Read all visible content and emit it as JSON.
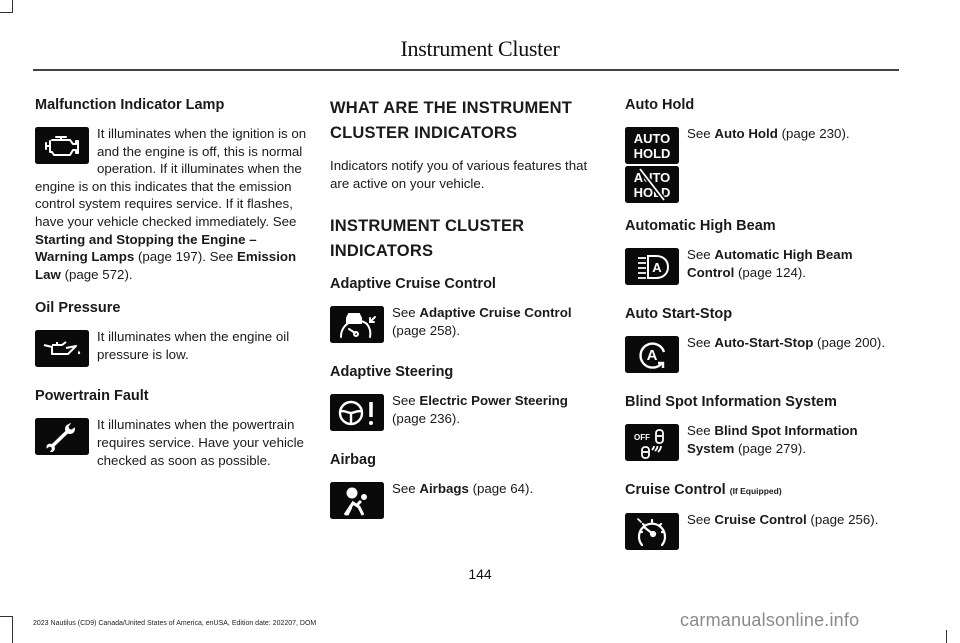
{
  "header": {
    "title": "Instrument Cluster"
  },
  "column1": {
    "sections": [
      {
        "heading": "Malfunction Indicator Lamp",
        "icon": "check-engine-icon",
        "text_a": "It illuminates when the ignition is on and the engine is off, this is normal operation. If it illuminates when the engine is on this indicates that the emission control system requires service. If it flashes, have your vehicle checked immediately.  See ",
        "link1": "Starting and Stopping the Engine – Warning Lamps",
        "text_b": " (page 197).   See ",
        "link2": "Emission Law",
        "text_c": " (page 572)."
      },
      {
        "heading": "Oil Pressure",
        "icon": "oil-can-icon",
        "text": "It illuminates when the engine oil pressure is low."
      },
      {
        "heading": "Powertrain Fault",
        "icon": "wrench-icon",
        "text": "It illuminates when the powertrain requires service.  Have your vehicle checked as soon as possible."
      }
    ]
  },
  "column2": {
    "main_heading": "WHAT ARE THE INSTRUMENT CLUSTER INDICATORS",
    "intro": "Indicators notify you of various features that are active on your vehicle.",
    "sub_heading": "INSTRUMENT CLUSTER INDICATORS",
    "sections": [
      {
        "heading": "Adaptive Cruise Control",
        "icon": "adaptive-cruise-icon",
        "see": "See ",
        "link": "Adaptive Cruise Control",
        "page": " (page 258)."
      },
      {
        "heading": "Adaptive Steering",
        "icon": "steering-warning-icon",
        "see": "See ",
        "link": "Electric Power Steering",
        "page": " (page 236)."
      },
      {
        "heading": "Airbag",
        "icon": "airbag-icon",
        "see": "See ",
        "link": "Airbags",
        "page": " (page 64)."
      }
    ]
  },
  "column3": {
    "sections": [
      {
        "heading": "Auto Hold",
        "icon": "auto-hold-icon",
        "icon_text_1": "AUTO",
        "icon_text_2": "HOLD",
        "see": "See ",
        "link": "Auto Hold",
        "page": " (page 230)."
      },
      {
        "heading": "Automatic High Beam",
        "icon": "auto-high-beam-icon",
        "icon_letter": "A",
        "see": "See ",
        "link": "Automatic High Beam Control",
        "page": " (page 124)."
      },
      {
        "heading": "Auto Start-Stop",
        "icon": "auto-start-stop-icon",
        "icon_letter": "A",
        "see": "See ",
        "link": "Auto-Start-Stop",
        "page": " (page 200)."
      },
      {
        "heading": "Blind Spot Information System",
        "icon": "blind-spot-off-icon",
        "icon_text": "OFF",
        "see": "See ",
        "link": "Blind Spot Information System",
        "page": " (page 279)."
      },
      {
        "heading": "Cruise Control",
        "heading_note": "(If Equipped)",
        "icon": "cruise-control-icon",
        "see": "See ",
        "link": "Cruise Control",
        "page": " (page 256)."
      }
    ]
  },
  "page_number": "144",
  "footer": "2023 Nautilus (CD9) Canada/United States of America, enUSA, Edition date: 202207, DOM",
  "watermark": "carmanualsonline.info"
}
